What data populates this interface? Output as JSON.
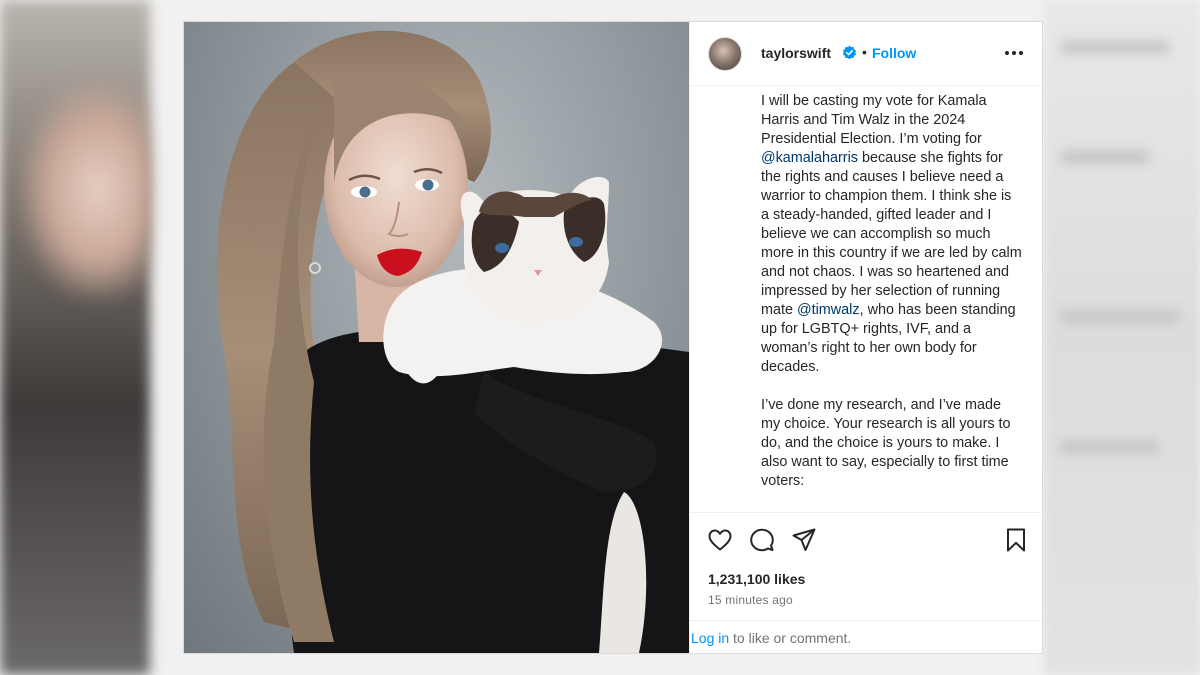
{
  "post": {
    "username": "taylorswift",
    "separator": "•",
    "follow_label": "Follow",
    "caption": [
      {
        "text": "I will be casting my vote for Kamala Harris and Tim Walz in the 2024 Presidential Election. I’m voting for "
      },
      {
        "text": "@kamalaharris",
        "mention": true
      },
      {
        "text": " because she fights for the rights and causes I believe need a warrior to champion them. I think she is a steady-handed, gifted leader and I believe we can accomplish so much more in this country if we are led by calm and not chaos. I was so heartened and impressed by her selection of running mate "
      },
      {
        "text": "@timwalz",
        "mention": true
      },
      {
        "text": ", who has been standing up for LGBTQ+ rights, IVF, and a woman’s right to her own body for decades.\n\nI’ve done my research, and I’ve made my choice. Your research is all yours to do, and the choice is yours to make. I also want to say, especially to first time voters:"
      }
    ],
    "likes": "1,231,100 likes",
    "time": "15 minutes ago",
    "footer": {
      "login_label": "Log in",
      "rest": " to like or comment."
    }
  },
  "icons": {
    "verified": "verified-badge-icon",
    "more": "more-options-icon",
    "like": "heart-icon",
    "comment": "comment-icon",
    "share": "share-icon",
    "save": "bookmark-icon"
  },
  "colors": {
    "accent": "#0095f6",
    "mention": "#00376b",
    "text": "#262626",
    "muted": "#737373"
  }
}
